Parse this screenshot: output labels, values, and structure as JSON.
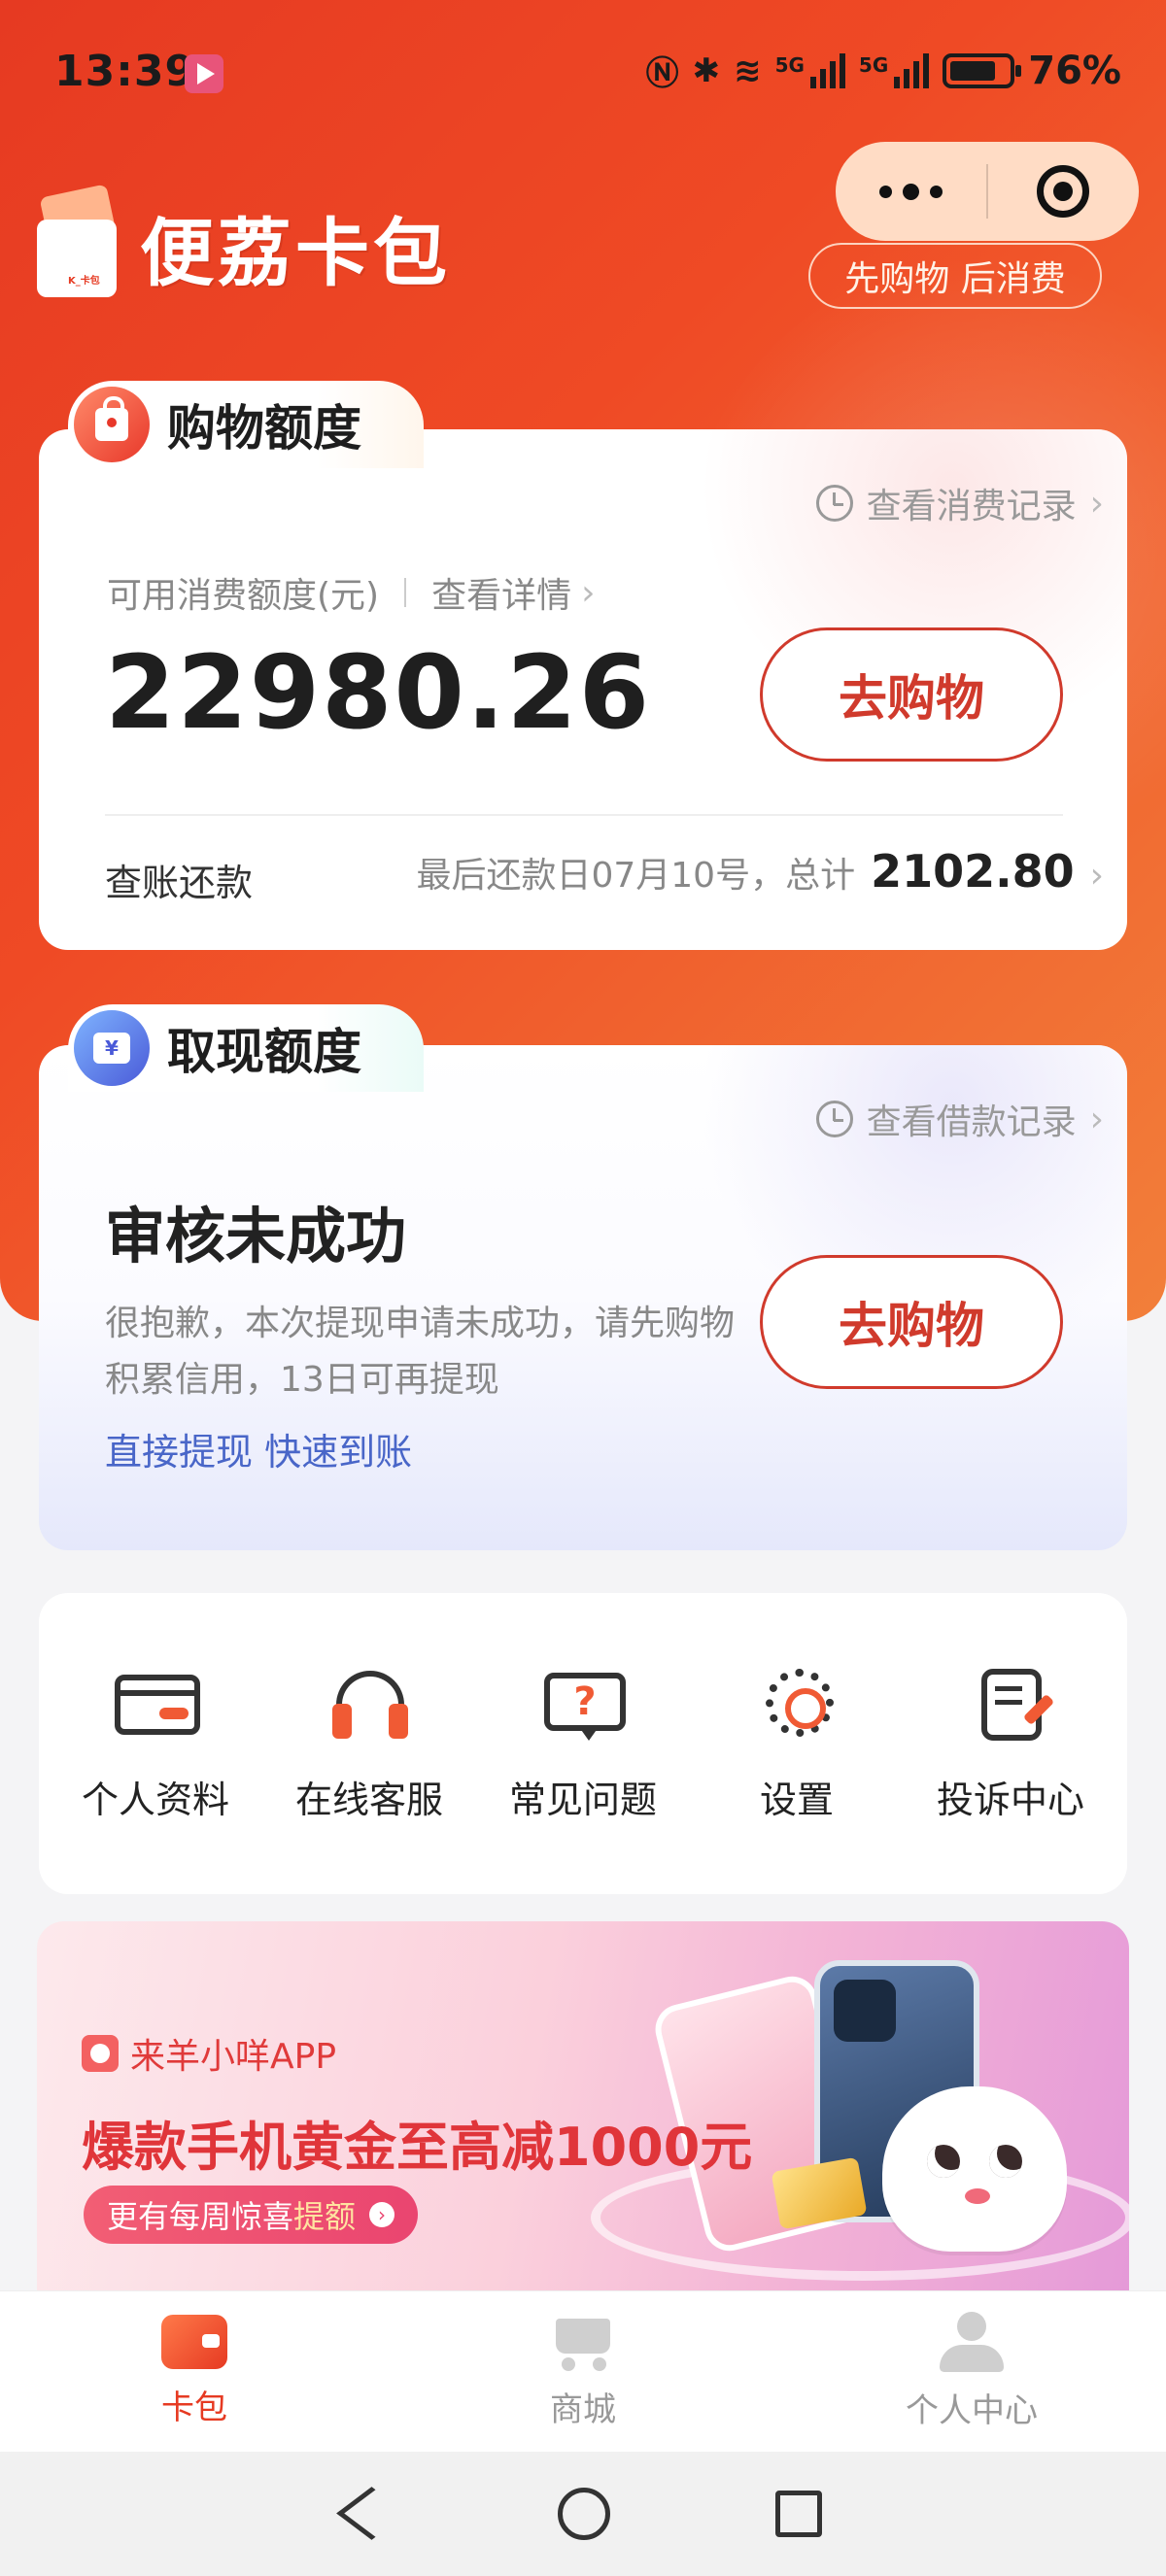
{
  "status_bar": {
    "time": "13:39",
    "battery": "76%",
    "signal1_label": "5G",
    "signal2_label": "5G",
    "icons": [
      "nfc-icon",
      "bluetooth-icon",
      "wifi-icon",
      "signal-icon",
      "signal-icon",
      "battery-icon"
    ]
  },
  "header": {
    "app_name": "便荔卡包",
    "slogan": "先购物 后消费",
    "capsule_icons": [
      "more-icon",
      "close-icon"
    ]
  },
  "shopping_card": {
    "tab_title": "购物额度",
    "record_link": "查看消费记录",
    "credit_label": "可用消费额度(元)",
    "detail_link": "查看详情",
    "amount": "22980.26",
    "button": "去购物",
    "bill_label": "查账还款",
    "bill_info": "最后还款日07月10号，总计",
    "bill_total": "2102.80"
  },
  "cash_card": {
    "tab_title": "取现额度",
    "record_link": "查看借款记录",
    "status_title": "审核未成功",
    "description": "很抱歉，本次提现申请未成功，请先购物积累信用，13日可再提现",
    "link": "直接提现 快速到账",
    "button": "去购物"
  },
  "menu": {
    "items": [
      {
        "label": "个人资料",
        "icon": "card-icon"
      },
      {
        "label": "在线客服",
        "icon": "headset-icon"
      },
      {
        "label": "常见问题",
        "icon": "faq-icon"
      },
      {
        "label": "设置",
        "icon": "gear-icon"
      },
      {
        "label": "投诉中心",
        "icon": "complaint-icon"
      }
    ]
  },
  "banner": {
    "app_name": "来羊小咩APP",
    "headline": "爆款手机黄金至高减1000元",
    "pill_text": "更有每周惊喜",
    "pill_highlight": "提额"
  },
  "tabbar": {
    "items": [
      {
        "label": "卡包",
        "active": true
      },
      {
        "label": "商城",
        "active": false
      },
      {
        "label": "个人中心",
        "active": false
      }
    ]
  },
  "colors": {
    "primary": "#e63a22",
    "button_red": "#d03a2c",
    "link_blue": "#4966c8",
    "icon_accent": "#f05a34"
  }
}
